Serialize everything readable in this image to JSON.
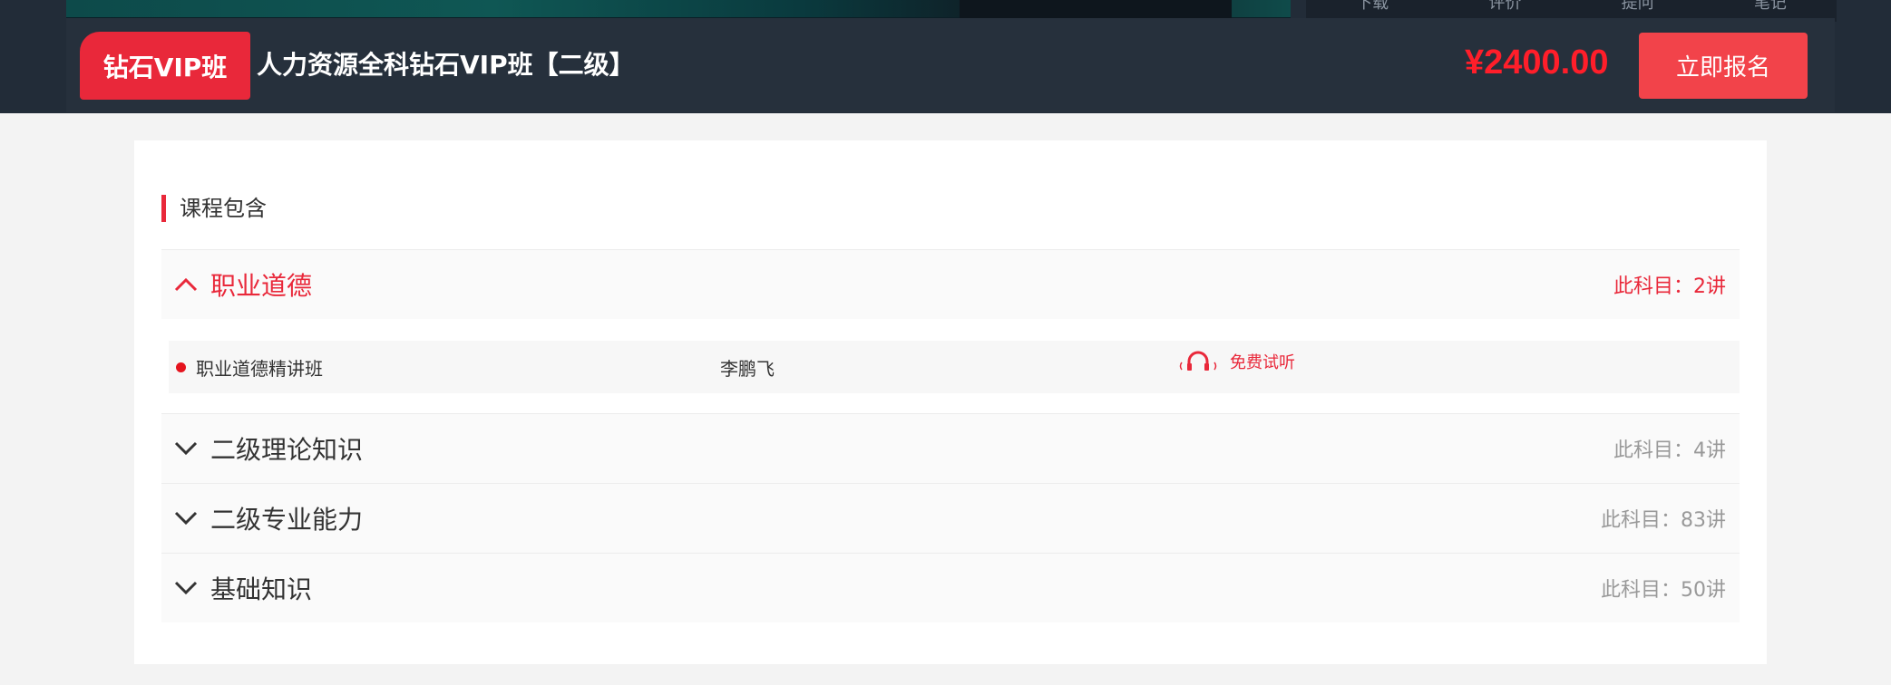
{
  "colors": {
    "accent": "#e9283a",
    "price": "#ff1e2a",
    "topbar": "#222c38",
    "enroll": "#f2434a"
  },
  "player_tabs": [
    "下载",
    "评价",
    "提问",
    "笔记"
  ],
  "course": {
    "badge": "钻石VIP班",
    "title": "人力资源全科钻石VIP班【二级】",
    "price": "¥2400.00",
    "enroll_label": "立即报名"
  },
  "contents": {
    "heading": "课程包含",
    "subjects": [
      {
        "name": "职业道德",
        "count": "此科目：2讲",
        "expanded": true,
        "lessons": [
          {
            "name": "职业道德精讲班",
            "teacher": "李鹏飞",
            "trial_label": "免费试听",
            "icon": "headphones-icon"
          }
        ]
      },
      {
        "name": "二级理论知识",
        "count": "此科目：4讲",
        "expanded": false
      },
      {
        "name": "二级专业能力",
        "count": "此科目：83讲",
        "expanded": false
      },
      {
        "name": "基础知识",
        "count": "此科目：50讲",
        "expanded": false
      }
    ]
  }
}
